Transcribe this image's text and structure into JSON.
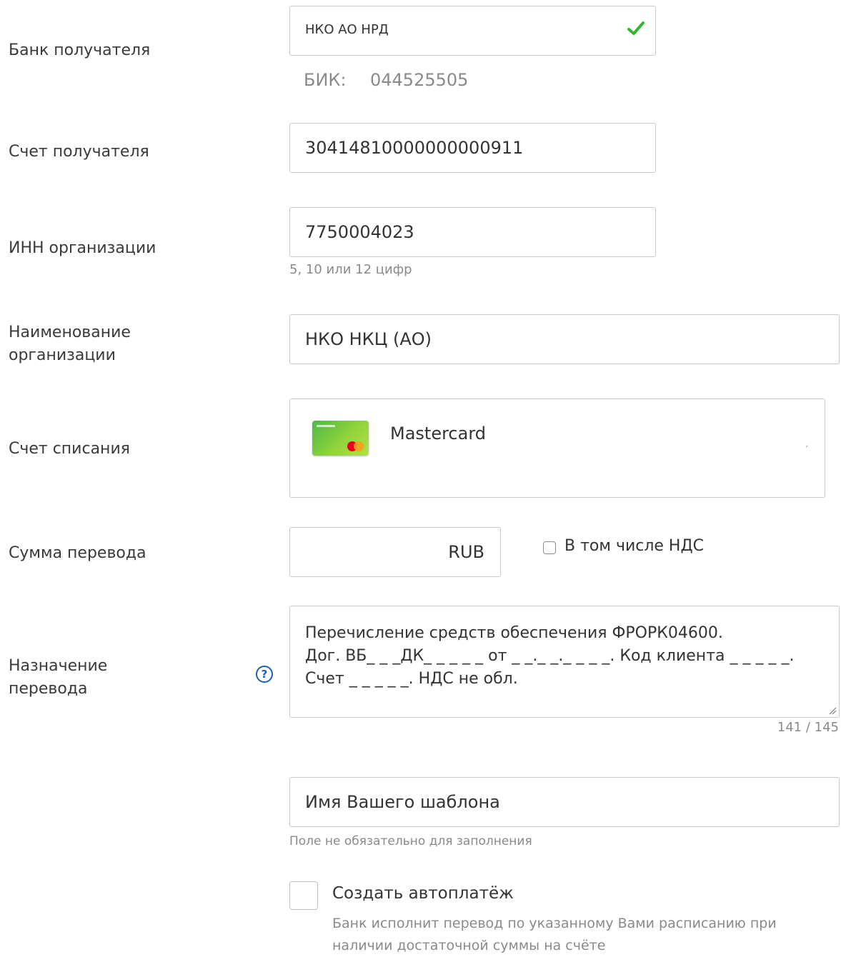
{
  "recipient_bank": {
    "label": "Банк получателя",
    "value": "НКО АО НРД",
    "bik_label": "БИК:",
    "bik_value": "044525505",
    "status_icon": "check-icon",
    "status_color": "#2eb82e"
  },
  "recipient_account": {
    "label": "Счет получателя",
    "value": "30414810000000000911"
  },
  "inn": {
    "label": "ИНН организации",
    "value": "7750004023",
    "hint": "5, 10 или 12 цифр"
  },
  "org_name": {
    "label_line1": "Наименование",
    "label_line2": "организации",
    "value": "НКО НКЦ (АО)"
  },
  "debit_account": {
    "label": "Счет списания",
    "card_name": "Mastercard",
    "card_icon": "card-thumbnail",
    "trailing_mark": "ˏ"
  },
  "amount": {
    "label": "Сумма перевода",
    "value": "",
    "currency": "RUB",
    "vat_label": "В том числе НДС",
    "vat_checked": false
  },
  "purpose": {
    "label_line1": "Назначение",
    "label_line2": "перевода",
    "help_icon": "help-icon",
    "help_glyph": "?",
    "line1": "Перечисление средств обеспечения ФРОРК04600.",
    "line2": "Дог. ВБ_ _ _ДК_ _ _ _ _ от _ _._ _._ _ _ _. Код клиента _ _ _ _ _.",
    "line3": "Счет _ _ _ _ _. НДС не обл.",
    "counter": "141 / 145"
  },
  "template": {
    "placeholder": "Имя Вашего шаблона",
    "hint": "Поле не обязательно для заполнения"
  },
  "autopay": {
    "label": "Создать автоплатёж",
    "checked": false,
    "description_line1": "Банк исполнит перевод по указанному Вами расписанию при",
    "description_line2": "наличии достаточной суммы на счёте"
  },
  "colors": {
    "accent": "#1a5fb4",
    "border": "#c9c9c9",
    "muted_text": "#8a8a8a",
    "success": "#2eb82e"
  }
}
